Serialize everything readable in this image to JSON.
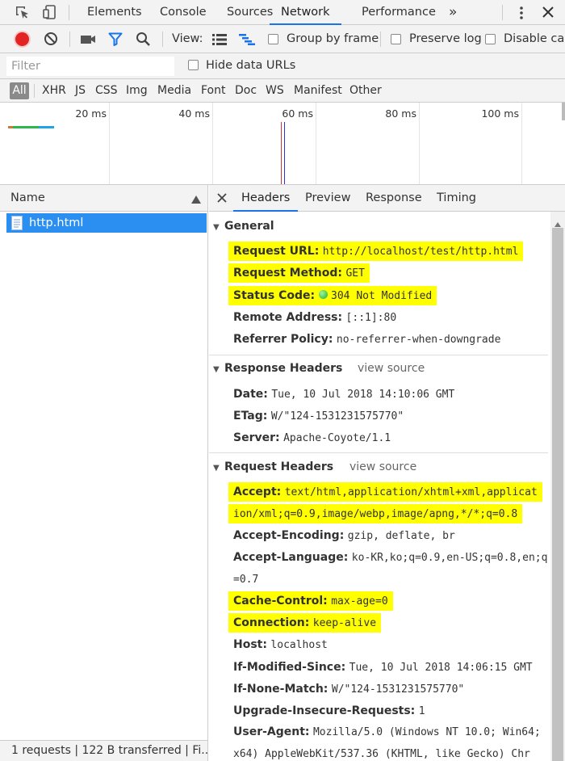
{
  "tabs": [
    "Elements",
    "Console",
    "Sources",
    "Network",
    "Performance"
  ],
  "more_tabs": "»",
  "toolbar": {
    "view_label": "View:",
    "group_by_frame": "Group by frame",
    "preserve_log": "Preserve log",
    "disable_cache": "Disable cac"
  },
  "filter": {
    "placeholder": "Filter",
    "hide_data_urls": "Hide data URLs"
  },
  "types": [
    "All",
    "XHR",
    "JS",
    "CSS",
    "Img",
    "Media",
    "Font",
    "Doc",
    "WS",
    "Manifest",
    "Other"
  ],
  "overview": {
    "labels": [
      "20 ms",
      "40 ms",
      "60 ms",
      "80 ms",
      "100 ms"
    ]
  },
  "requests": {
    "header": "Name",
    "items": [
      "http.html"
    ]
  },
  "status_bar": "1 requests  |  122 B transferred  |  Fi...",
  "detail_tabs": [
    "Headers",
    "Preview",
    "Response",
    "Timing"
  ],
  "general": {
    "title": "General",
    "rows": [
      {
        "key": "Request URL:",
        "value": "http://localhost/test/http.html"
      },
      {
        "key": "Request Method:",
        "value": "GET"
      },
      {
        "key": "Status Code:",
        "value": "304 Not Modified"
      },
      {
        "key": "Remote Address:",
        "value": "[::1]:80"
      },
      {
        "key": "Referrer Policy:",
        "value": "no-referrer-when-downgrade"
      }
    ]
  },
  "response_headers": {
    "title": "Response Headers",
    "view_source": "view source",
    "rows": [
      {
        "key": "Date:",
        "value": "Tue, 10 Jul 2018 14:10:06 GMT"
      },
      {
        "key": "ETag:",
        "value": "W/\"124-1531231575770\""
      },
      {
        "key": "Server:",
        "value": "Apache-Coyote/1.1"
      }
    ]
  },
  "request_headers": {
    "title": "Request Headers",
    "view_source": "view source",
    "rows": [
      {
        "key": "Accept:",
        "value": "text/html,application/xhtml+xml,applicat",
        "value2": "ion/xml;q=0.9,image/webp,image/apng,*/*;q=0.8"
      },
      {
        "key": "Accept-Encoding:",
        "value": "gzip, deflate, br"
      },
      {
        "key": "Accept-Language:",
        "value": "ko-KR,ko;q=0.9,en-US;q=0.8,en;q",
        "value2": "=0.7"
      },
      {
        "key": "Cache-Control:",
        "value": "max-age=0"
      },
      {
        "key": "Connection:",
        "value": "keep-alive"
      },
      {
        "key": "Host:",
        "value": "localhost"
      },
      {
        "key": "If-Modified-Since:",
        "value": "Tue, 10 Jul 2018 14:06:15 GMT"
      },
      {
        "key": "If-None-Match:",
        "value": "W/\"124-1531231575770\""
      },
      {
        "key": "Upgrade-Insecure-Requests:",
        "value": "1"
      },
      {
        "key": "User-Agent:",
        "value": "Mozilla/5.0 (Windows NT 10.0; Win64;",
        "value2": "x64) AppleWebKit/537.36 (KHTML, like Gecko) Chr"
      }
    ]
  },
  "colors": {
    "accent": "#1a73e8",
    "highlight": "#ffff00",
    "record": "#e22424",
    "status_ok": "#3bbf3b"
  }
}
